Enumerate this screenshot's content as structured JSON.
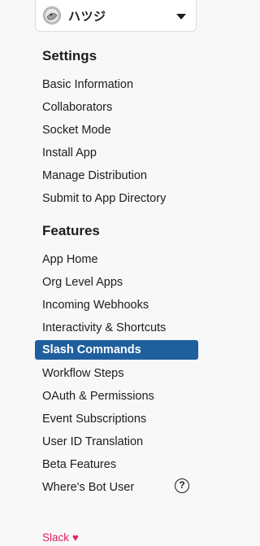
{
  "app": {
    "name": "ハツジ"
  },
  "sections": {
    "settings": {
      "title": "Settings",
      "items": [
        "Basic Information",
        "Collaborators",
        "Socket Mode",
        "Install App",
        "Manage Distribution",
        "Submit to App Directory"
      ]
    },
    "features": {
      "title": "Features",
      "items": [
        "App Home",
        "Org Level Apps",
        "Incoming Webhooks",
        "Interactivity & Shortcuts",
        "Slash Commands",
        "Workflow Steps",
        "OAuth & Permissions",
        "Event Subscriptions",
        "User ID Translation",
        "Beta Features",
        "Where's Bot User"
      ],
      "active_item": "Slash Commands"
    }
  },
  "help_icon_glyph": "?",
  "footer": {
    "brand": "Slack",
    "heart": "♥"
  },
  "colors": {
    "active_background": "#1f5f9e",
    "footer_accent": "#e01e5a"
  }
}
